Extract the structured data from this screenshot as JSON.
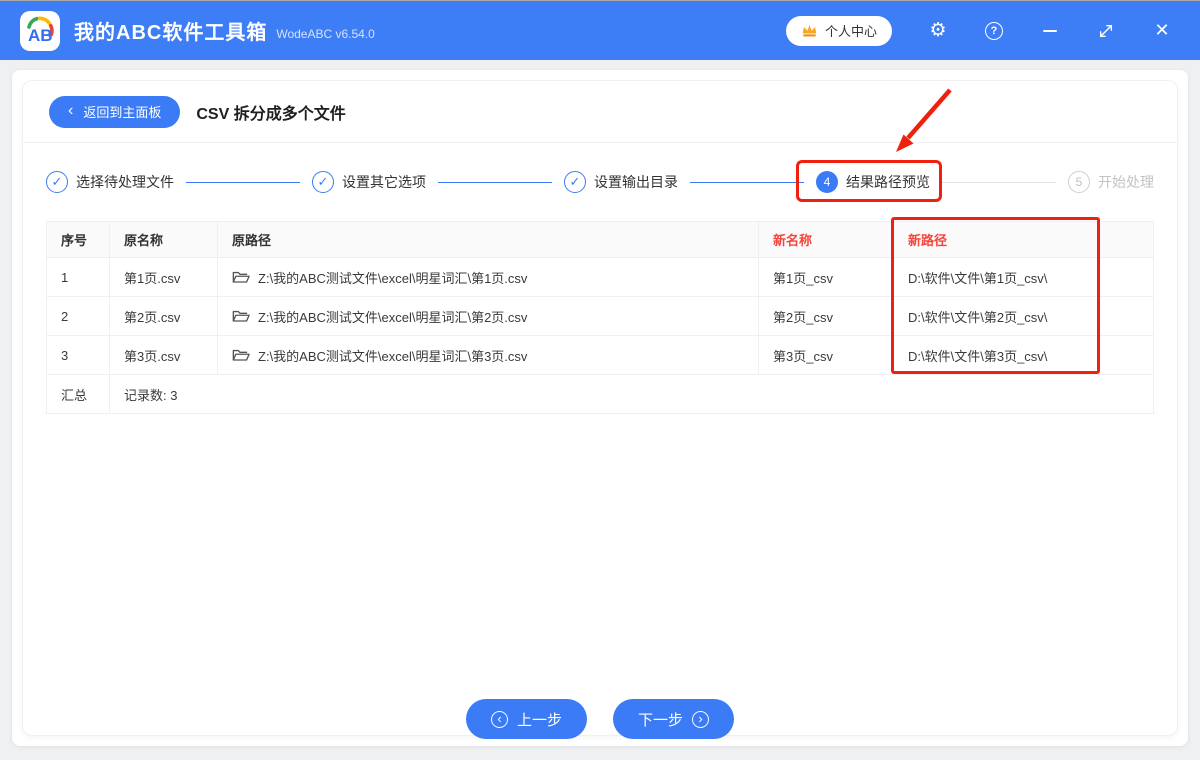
{
  "titlebar": {
    "logo_text": "AB",
    "app_title": "我的ABC软件工具箱",
    "version": "WodeABC v6.54.0",
    "user_center_label": "个人中心"
  },
  "header": {
    "back_label": "返回到主面板",
    "title": "CSV 拆分成多个文件"
  },
  "icons": {
    "check": "✓",
    "back_chevron": "‹",
    "prev_chevron": "‹",
    "next_chevron": "›",
    "gear": "⚙",
    "help": "?",
    "close": "✕"
  },
  "stepper": {
    "steps": [
      {
        "label": "选择待处理文件",
        "state": "done"
      },
      {
        "label": "设置其它选项",
        "state": "done"
      },
      {
        "label": "设置输出目录",
        "state": "done"
      },
      {
        "label": "结果路径预览",
        "state": "active",
        "number": "4"
      },
      {
        "label": "开始处理",
        "state": "pending",
        "number": "5"
      }
    ]
  },
  "table": {
    "headers": {
      "index": "序号",
      "name": "原名称",
      "path": "原路径",
      "new_name": "新名称",
      "new_path": "新路径"
    },
    "rows": [
      {
        "index": "1",
        "name": "第1页.csv",
        "path": "Z:\\我的ABC测试文件\\excel\\明星词汇\\第1页.csv",
        "new_name": "第1页_csv",
        "new_path": "D:\\软件\\文件\\第1页_csv\\"
      },
      {
        "index": "2",
        "name": "第2页.csv",
        "path": "Z:\\我的ABC测试文件\\excel\\明星词汇\\第2页.csv",
        "new_name": "第2页_csv",
        "new_path": "D:\\软件\\文件\\第2页_csv\\"
      },
      {
        "index": "3",
        "name": "第3页.csv",
        "path": "Z:\\我的ABC测试文件\\excel\\明星词汇\\第3页.csv",
        "new_name": "第3页_csv",
        "new_path": "D:\\软件\\文件\\第3页_csv\\"
      }
    ],
    "summary": {
      "label": "汇总",
      "text": "记录数: 3"
    }
  },
  "footer": {
    "prev_label": "上一步",
    "next_label": "下一步"
  },
  "colors": {
    "accent_blue": "#3b7bf6",
    "titlebar_blue": "#3d7ef7",
    "annotation_red": "#f0200f",
    "header_red": "#f5463d"
  }
}
